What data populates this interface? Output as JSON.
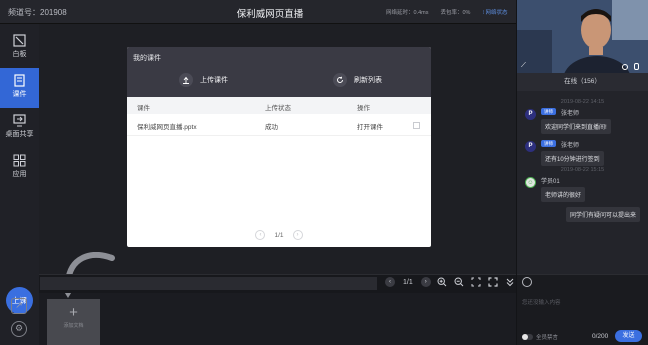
{
  "header": {
    "channel": "频道号：201908",
    "title": "保利威网页直播",
    "latency": "网络延时：0.4ms",
    "packet_loss": "丢包率：0%",
    "network_status": "网络状态"
  },
  "sidebar": {
    "items": [
      {
        "label": "白板",
        "icon": "whiteboard-icon"
      },
      {
        "label": "课件",
        "icon": "courseware-icon",
        "active": true
      },
      {
        "label": "桌面共享",
        "icon": "screen-share-icon"
      },
      {
        "label": "应用",
        "icon": "apps-icon"
      }
    ],
    "start_class": "上课"
  },
  "dialog": {
    "title": "我的课件",
    "upload": "上传课件",
    "refresh": "刷新列表",
    "columns": [
      "课件",
      "上传状态",
      "操作"
    ],
    "rows": [
      {
        "name": "保利威网页直播.pptx",
        "status": "成功",
        "action": "打开课件"
      }
    ],
    "pager": "1/1"
  },
  "add_doc": {
    "label": "添加文档"
  },
  "toolbar": {
    "page": "1/1"
  },
  "online": "在线（156）",
  "chat": {
    "messages": [
      {
        "time": "2019-08-22 14:15",
        "role": "讲师",
        "sender": "张老师",
        "text": "欢迎同学们来到直播间!",
        "avatar": "P"
      },
      {
        "time": "",
        "role": "讲师",
        "sender": "张老师",
        "text": "还有10分钟进行签到",
        "avatar": "P"
      },
      {
        "time": "2019-08-22 15:15",
        "role": "",
        "sender": "学员01",
        "text": "老师讲的很好",
        "avatar": "S"
      }
    ],
    "self_message": "同学们有疑问可以提出来",
    "placeholder": "您还没输入内容",
    "mute_label": "全员禁言",
    "count": "0/200",
    "send": "发送"
  },
  "colors": {
    "accent": "#3b6fe0",
    "bg": "#1b1c21"
  }
}
